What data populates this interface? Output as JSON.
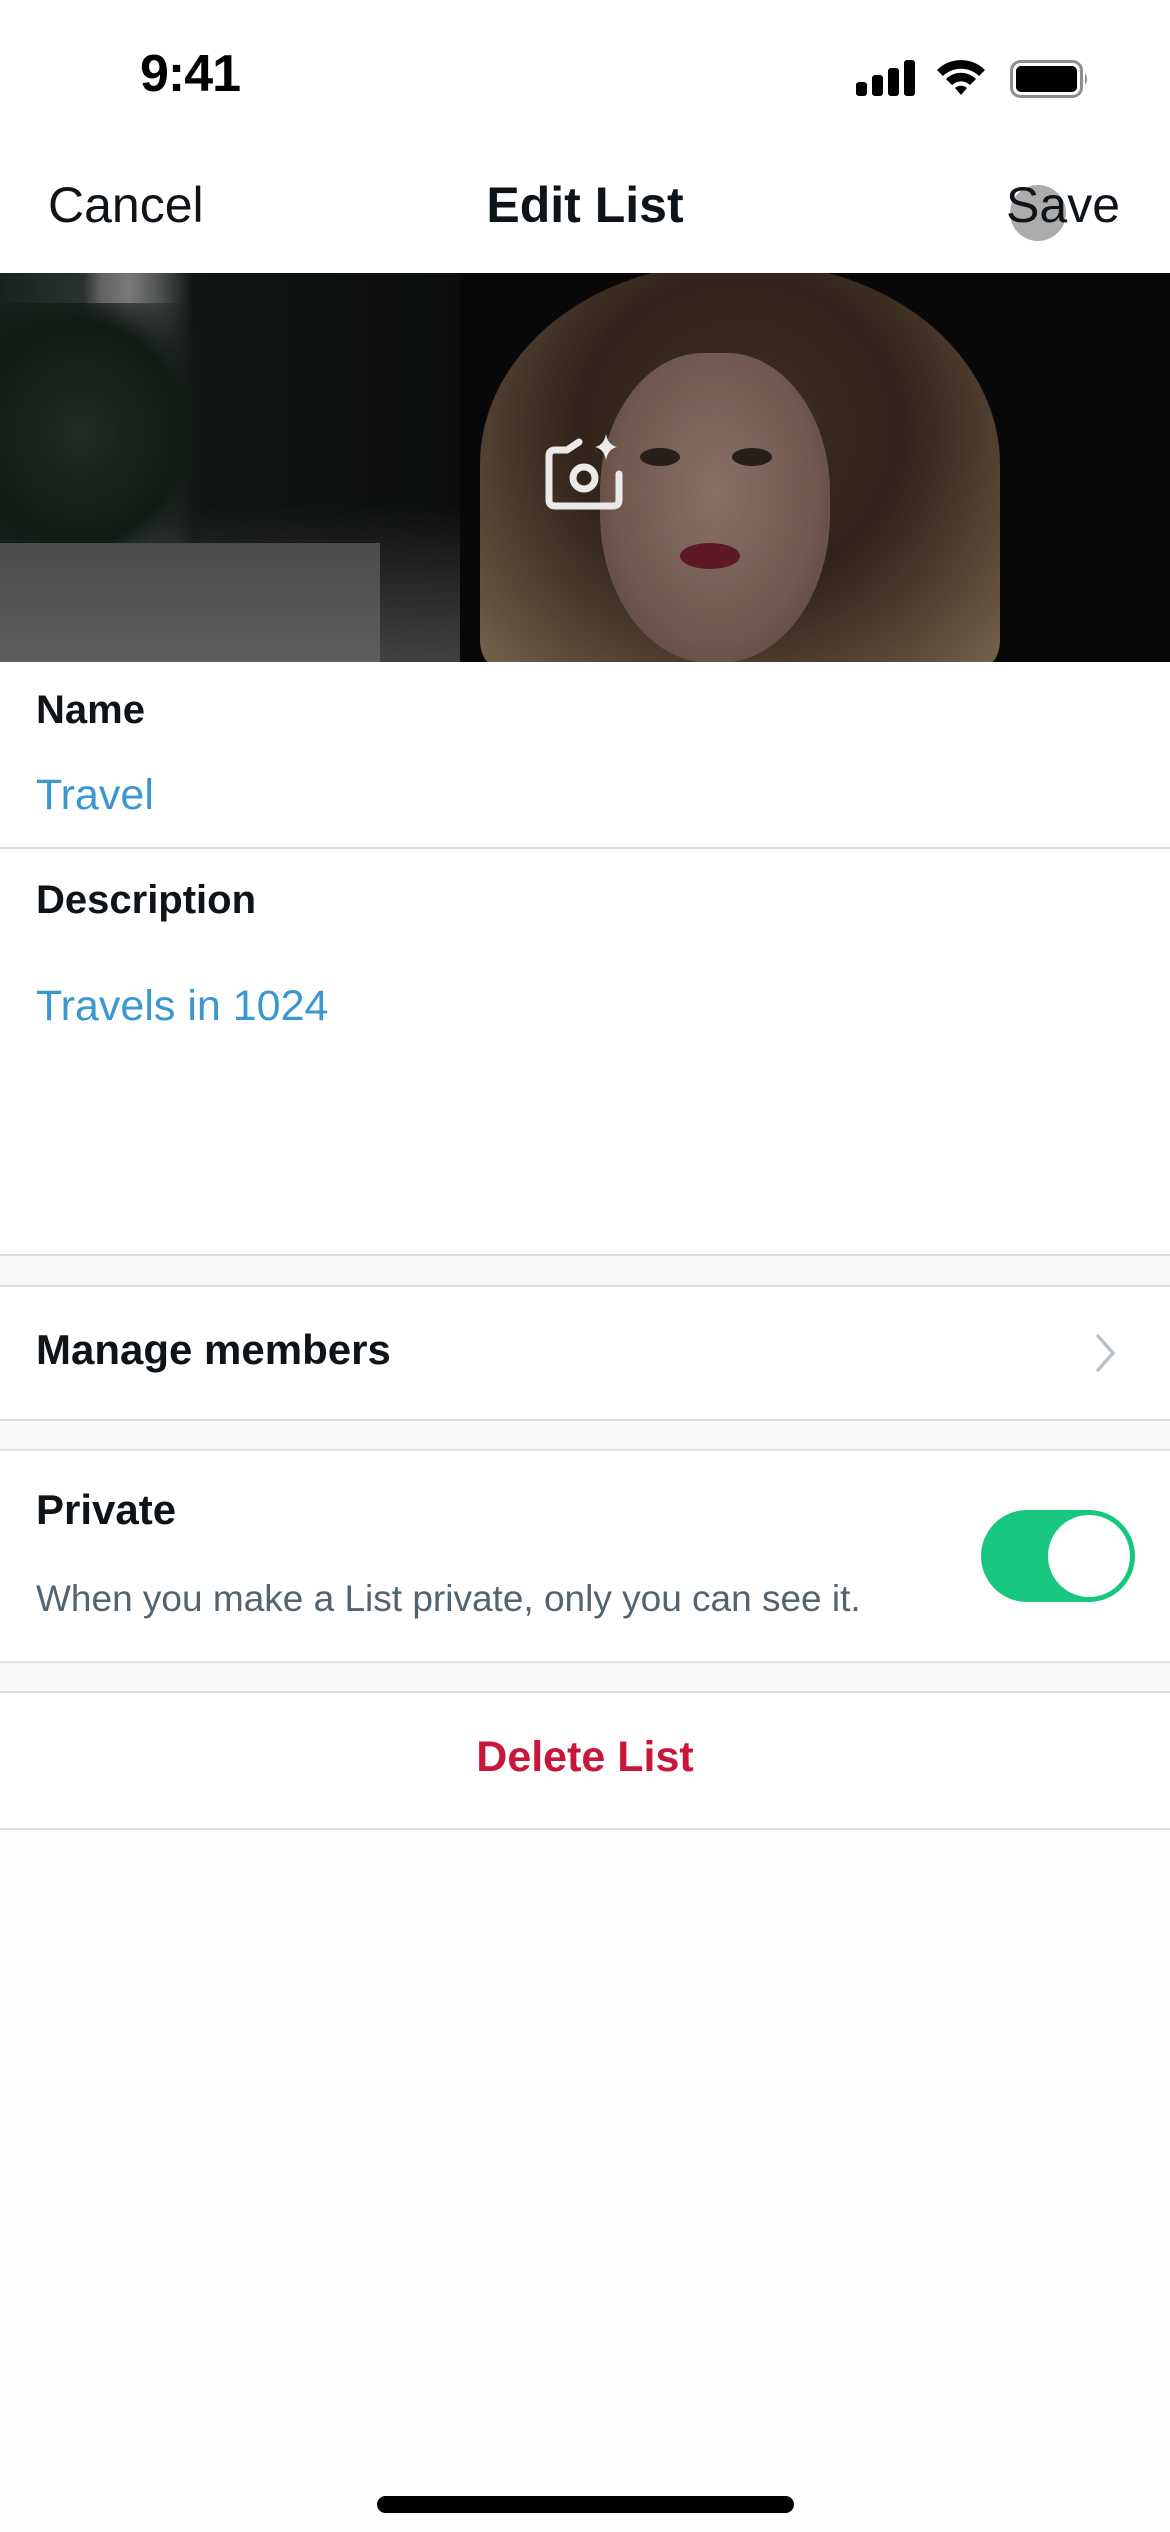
{
  "status_bar": {
    "time": "9:41",
    "icons": [
      "cellular-signal-icon",
      "wifi-icon",
      "battery-icon"
    ]
  },
  "nav": {
    "cancel_label": "Cancel",
    "title": "Edit List",
    "save_label": "Save"
  },
  "banner": {
    "image_description": "woman with long hair on a tree-lined city street",
    "edit_icon": "camera-sparkle-icon"
  },
  "form": {
    "name": {
      "label": "Name",
      "value": "Travel"
    },
    "description": {
      "label": "Description",
      "value": "Travels in 1024"
    }
  },
  "manage_members": {
    "label": "Manage members",
    "icon": "chevron-right-icon"
  },
  "private": {
    "label": "Private",
    "description": "When you make a List private, only you can see it.",
    "enabled": true
  },
  "delete": {
    "label": "Delete List"
  },
  "colors": {
    "accent_blue": "#3a97cf",
    "toggle_on": "#17c77e",
    "destructive": "#c9173c",
    "secondary_text": "#536471"
  }
}
